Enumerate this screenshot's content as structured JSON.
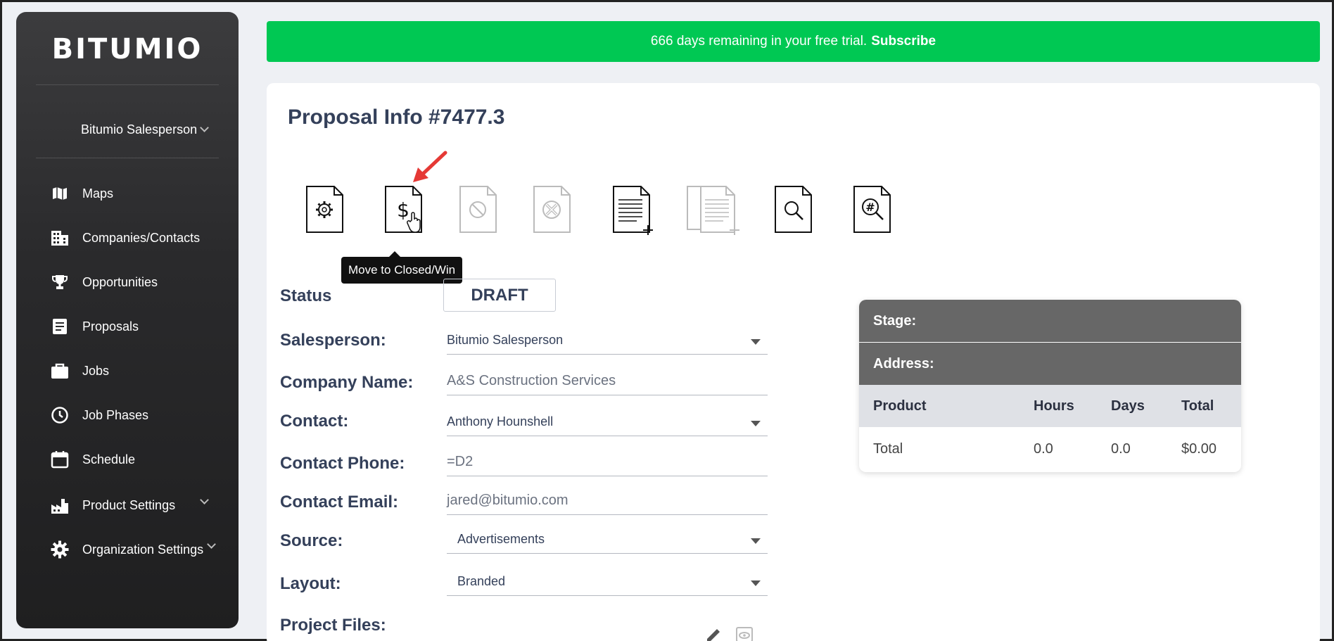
{
  "sidebar": {
    "logo": "BITUMIO",
    "user": "Bitumio Salesperson",
    "items": [
      {
        "label": "Maps",
        "icon": "map-icon"
      },
      {
        "label": "Companies/Contacts",
        "icon": "building-icon"
      },
      {
        "label": "Opportunities",
        "icon": "trophy-icon"
      },
      {
        "label": "Proposals",
        "icon": "document-icon"
      },
      {
        "label": "Jobs",
        "icon": "briefcase-icon"
      },
      {
        "label": "Job Phases",
        "icon": "clock-icon"
      },
      {
        "label": "Schedule",
        "icon": "calendar-icon"
      },
      {
        "label": "Product Settings",
        "icon": "factory-icon"
      },
      {
        "label": "Organization Settings",
        "icon": "gear-icon"
      }
    ]
  },
  "banner": {
    "text": "666 days remaining in your free trial.",
    "link": "Subscribe"
  },
  "page": {
    "title": "Proposal Info #7477.3",
    "tooltip": "Move to Closed/Win"
  },
  "toolbar": [
    {
      "name": "proposal-settings-icon"
    },
    {
      "name": "move-to-closed-win-icon"
    },
    {
      "name": "cancel-proposal-icon"
    },
    {
      "name": "delete-proposal-icon"
    },
    {
      "name": "new-document-icon"
    },
    {
      "name": "duplicate-document-icon"
    },
    {
      "name": "preview-document-icon"
    },
    {
      "name": "search-number-icon"
    }
  ],
  "form": {
    "status_label": "Status",
    "status_value": "DRAFT",
    "salesperson_label": "Salesperson:",
    "salesperson_value": "Bitumio Salesperson",
    "company_label": "Company Name:",
    "company_value": "A&S Construction Services",
    "contact_label": "Contact:",
    "contact_value": "Anthony Hounshell",
    "phone_label": "Contact Phone:",
    "phone_value": "=D2",
    "email_label": "Contact Email:",
    "email_value": "jared@bitumio.com",
    "source_label": "Source:",
    "source_value": "Advertisements",
    "layout_label": "Layout:",
    "layout_value": "Branded",
    "files_label": "Project Files:"
  },
  "summary": {
    "stage_label": "Stage:",
    "address_label": "Address:",
    "headers": [
      "Product",
      "Hours",
      "Days",
      "Total"
    ],
    "total_row": [
      "Total",
      "0.0",
      "0.0",
      "$0.00"
    ]
  },
  "colors": {
    "banner": "#00c853",
    "sidebar": "#2a2a2c",
    "accent_text": "#34405a",
    "arrow": "#e53935"
  }
}
